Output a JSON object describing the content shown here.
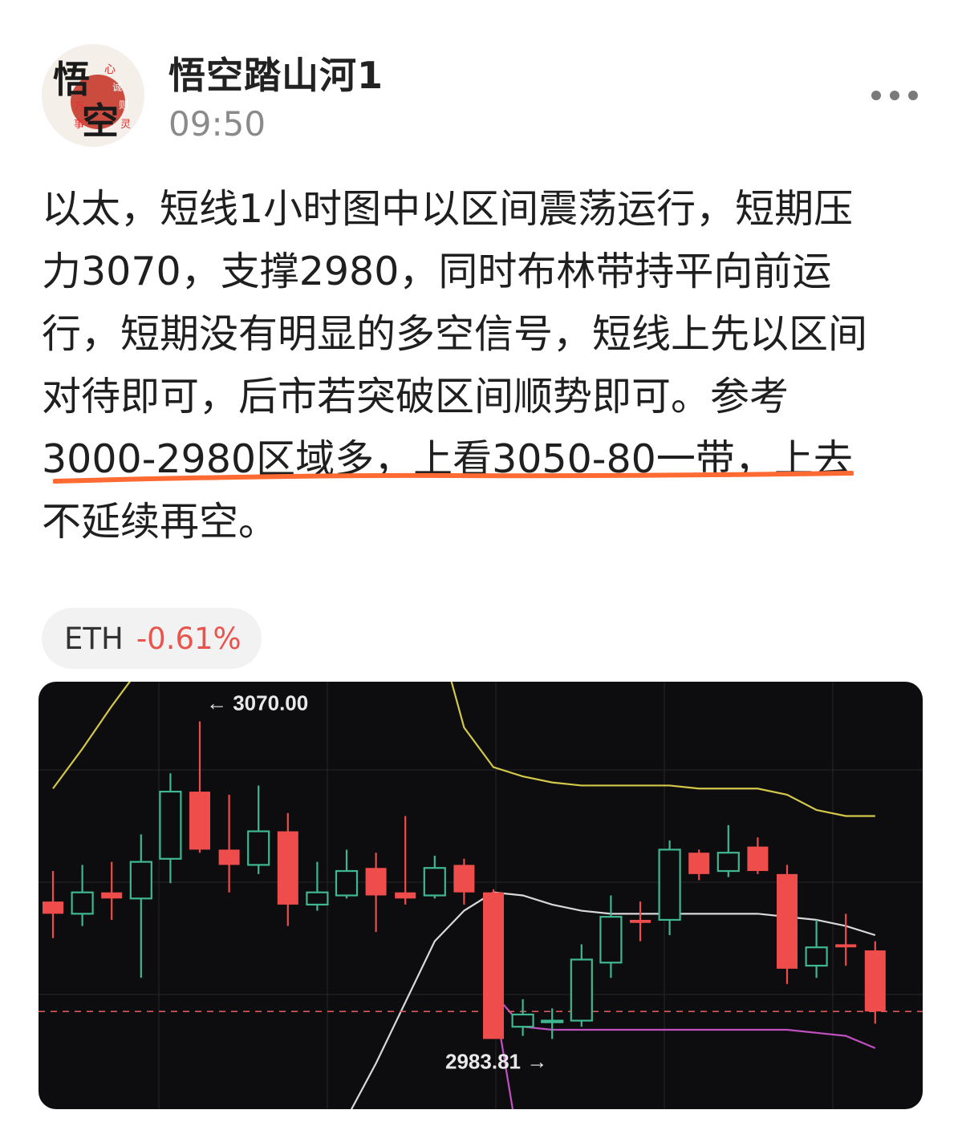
{
  "header": {
    "author": "悟空踏山河1",
    "time": "09:50",
    "avatar_chars": [
      "悟",
      "空",
      "心",
      "诚",
      "则",
      "灵",
      "万",
      "事"
    ],
    "more_icon": "more-horizontal-icon"
  },
  "post": {
    "lines": [
      "以太，短线1小时图中以区间震荡运行，短期压",
      "力3070，支撑2980，同时布林带持平向前运",
      "行，短期没有明显的多空信号，短线上先以区间",
      "对待即可，后市若突破区间顺势即可。参考",
      "3000-2980区域多，上看3050-80一带，上去",
      "不延续再空。"
    ],
    "underline_color": "#ff6a33"
  },
  "tag": {
    "symbol": "ETH",
    "change": "-0.61%",
    "change_color": "#e8554e"
  },
  "chart_data": {
    "type": "candlestick",
    "annotations": {
      "high": "3070.00",
      "low": "2983.81"
    },
    "y_range": [
      2960,
      3100
    ],
    "reference_line": 2992,
    "candles": [
      {
        "o": 3028,
        "c": 3024,
        "h": 3038,
        "l": 3016
      },
      {
        "o": 3024,
        "c": 3031,
        "h": 3040,
        "l": 3020
      },
      {
        "o": 3031,
        "c": 3029,
        "h": 3041,
        "l": 3022
      },
      {
        "o": 3029,
        "c": 3041,
        "h": 3050,
        "l": 3003
      },
      {
        "o": 3042,
        "c": 3064,
        "h": 3070,
        "l": 3034
      },
      {
        "o": 3064,
        "c": 3045,
        "h": 3087,
        "l": 3044
      },
      {
        "o": 3045,
        "c": 3040,
        "h": 3063,
        "l": 3031
      },
      {
        "o": 3040,
        "c": 3051,
        "h": 3066,
        "l": 3037
      },
      {
        "o": 3051,
        "c": 3027,
        "h": 3057,
        "l": 3020
      },
      {
        "o": 3027,
        "c": 3031,
        "h": 3041,
        "l": 3025
      },
      {
        "o": 3030,
        "c": 3038,
        "h": 3045,
        "l": 3029
      },
      {
        "o": 3039,
        "c": 3030,
        "h": 3044,
        "l": 3018
      },
      {
        "o": 3031,
        "c": 3029,
        "h": 3056,
        "l": 3027
      },
      {
        "o": 3030,
        "c": 3039,
        "h": 3043,
        "l": 3029
      },
      {
        "o": 3040,
        "c": 3031,
        "h": 3042,
        "l": 3027
      },
      {
        "o": 3031,
        "c": 2983,
        "h": 3032,
        "l": 2983.81
      },
      {
        "o": 2987,
        "c": 2991,
        "h": 2996,
        "l": 2984
      },
      {
        "o": 2989,
        "c": 2989,
        "h": 2993,
        "l": 2983
      },
      {
        "o": 2989,
        "c": 3009,
        "h": 3014,
        "l": 2987
      },
      {
        "o": 3008,
        "c": 3023,
        "h": 3030,
        "l": 3003
      },
      {
        "o": 3022,
        "c": 3021,
        "h": 3028,
        "l": 3015
      },
      {
        "o": 3022,
        "c": 3045,
        "h": 3048,
        "l": 3017
      },
      {
        "o": 3044,
        "c": 3037,
        "h": 3045,
        "l": 3035
      },
      {
        "o": 3038,
        "c": 3044,
        "h": 3053,
        "l": 3036
      },
      {
        "o": 3046,
        "c": 3038,
        "h": 3049,
        "l": 3037
      },
      {
        "o": 3037,
        "c": 3006,
        "h": 3040,
        "l": 3001
      },
      {
        "o": 3007,
        "c": 3013,
        "h": 3022,
        "l": 3003
      },
      {
        "o": 3014,
        "c": 3013,
        "h": 3024,
        "l": 3007
      },
      {
        "o": 3012,
        "c": 2992,
        "h": 3015,
        "l": 2988
      }
    ],
    "upper_band": [
      3065,
      3078,
      3092,
      3105,
      3120,
      3135,
      3150,
      3165,
      3180,
      3195,
      3210,
      3225,
      3240,
      3120,
      3085,
      3072,
      3069,
      3067,
      3066,
      3066,
      3066,
      3066,
      3065,
      3065,
      3065,
      3063,
      3058,
      3056,
      3056
    ],
    "middle_band": [
      null,
      null,
      null,
      null,
      null,
      null,
      null,
      null,
      null,
      null,
      2957,
      2975,
      2995,
      3015,
      3025,
      3031,
      3030,
      3027,
      3025,
      3024,
      3024,
      3024,
      3024,
      3024,
      3024,
      3023,
      3022,
      3020,
      3017
    ],
    "lower_band": [
      null,
      null,
      null,
      null,
      null,
      null,
      null,
      null,
      null,
      null,
      null,
      null,
      null,
      null,
      null,
      2998,
      2987,
      2986,
      2986,
      2986,
      2986,
      2986,
      2986,
      2986,
      2986,
      2986,
      2985,
      2984,
      2980
    ],
    "lower_spike": [
      null,
      null,
      null,
      null,
      null,
      null,
      null,
      null,
      null,
      null,
      null,
      null,
      null,
      null,
      null,
      2998,
      2940
    ],
    "colors": {
      "up": "#3fb88f",
      "down": "#ef4c4c",
      "upper": "#d4c84a",
      "middle": "#d8d8d8",
      "lower": "#c050c0",
      "ref": "#d95a5a",
      "grid": "#26262a",
      "label": "#e8e8e8"
    }
  }
}
